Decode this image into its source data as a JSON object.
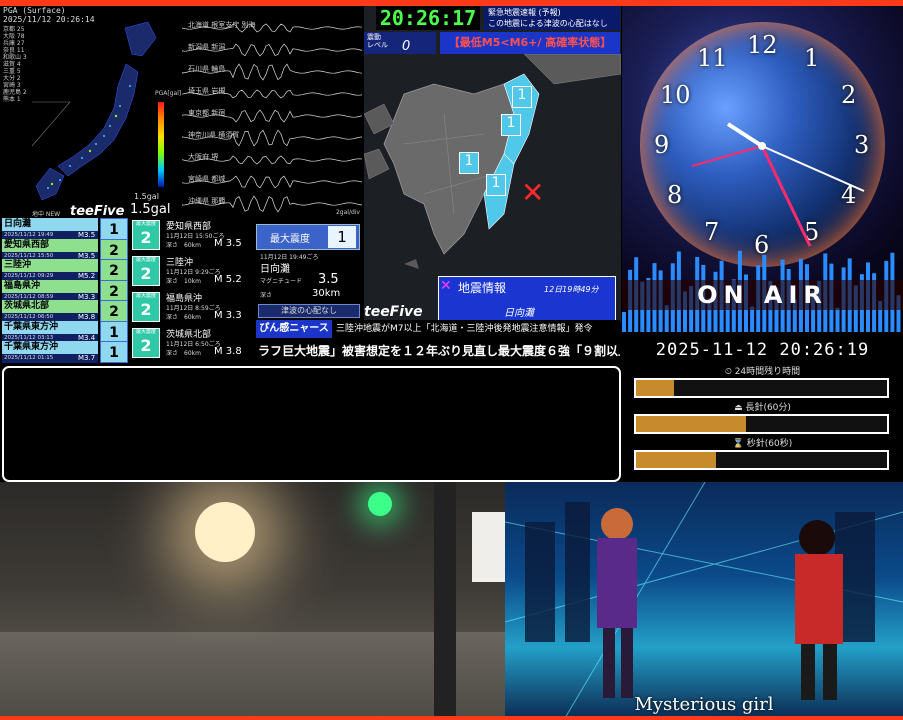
{
  "pga": {
    "title": "PGA (Surface)",
    "timestamp": "2025/11/12 20:26:14",
    "scale_title": "PGA[gal]",
    "gal_small": "1.5gal",
    "gal_large": "1.5gal",
    "stations": [
      "京都 25",
      "大阪 78",
      "兵庫 27",
      "奈良 11",
      "和歌山 3",
      "滋賀 4",
      "三重 5",
      "大分 2",
      "宮崎 3",
      "鹿児島 2",
      "熊本 1"
    ],
    "list_header": "最大1"
  },
  "waves": {
    "labels": [
      "北海道 根室支庁 別海",
      "新潟県 新潟",
      "石川県 輪島",
      "埼玉県 岩槻",
      "東京都 新宿",
      "神奈川県 横須賀",
      "大阪府 堺",
      "宮崎県 都城",
      "沖縄県 那覇"
    ],
    "footer": "2gal/div"
  },
  "eq_map": {
    "time": "20:26:17",
    "tsunami_line1": "緊急地震速報 (予報)",
    "tsunami_line2": "この地震による津波の心配はなし",
    "level_label_1": "震動",
    "level_label_2": "レベル",
    "level_value": "0",
    "banner": "【最低M5<M6+/ 高確率状態】",
    "info_title": "地震情報",
    "info_time": "12日19時49分",
    "info_place": "日向灘",
    "brand": "teeFive",
    "marker_values": [
      "1",
      "1",
      "1",
      "1"
    ]
  },
  "eq_list": {
    "brand": "teeFive",
    "new_label": "地中 NEW",
    "rows": [
      {
        "name": "日向灘",
        "time": "2025/11/12 19:49",
        "mag": "M3.5",
        "intensity": "1",
        "color": "#8fd8f0"
      },
      {
        "name": "愛知県西部",
        "time": "2025/11/12 15:50",
        "mag": "M3.5",
        "intensity": "2",
        "color": "#8ee08e"
      },
      {
        "name": "三陸沖",
        "time": "2025/11/12 09:29",
        "mag": "M5.2",
        "intensity": "2",
        "color": "#8ee08e"
      },
      {
        "name": "福島県沖",
        "time": "2025/11/12 08:59",
        "mag": "M3.3",
        "intensity": "2",
        "color": "#8ee08e"
      },
      {
        "name": "茨城県北部",
        "time": "2025/11/12 06:50",
        "mag": "M3.8",
        "intensity": "2",
        "color": "#8ee08e"
      },
      {
        "name": "千葉県東方沖",
        "time": "2025/11/12 03:13",
        "mag": "M3.4",
        "intensity": "1",
        "color": "#8fd8f0"
      },
      {
        "name": "千葉県東方沖",
        "time": "2025/11/12 01:15",
        "mag": "M3.7",
        "intensity": "1",
        "color": "#8fd8f0"
      }
    ]
  },
  "eq_cards": [
    {
      "intensity_label": "最大震度",
      "intensity": "2",
      "name": "愛知県西部",
      "time": "11月12日 15:50ごろ",
      "depth": "深さ　60km",
      "mag": "M 3.5"
    },
    {
      "intensity_label": "最大震度",
      "intensity": "2",
      "name": "三陸沖",
      "time": "11月12日 9:29ごろ",
      "depth": "深さ　10km",
      "mag": "M 5.2"
    },
    {
      "intensity_label": "最大震度",
      "intensity": "2",
      "name": "福島県沖",
      "time": "11月12日 8:59ごろ",
      "depth": "深さ　60km",
      "mag": "M 3.3"
    },
    {
      "intensity_label": "最大震度",
      "intensity": "2",
      "name": "茨城県北部",
      "time": "11月12日 6:50ごろ",
      "depth": "深さ　60km",
      "mag": "M 3.8"
    }
  ],
  "max_panel": {
    "label": "最大震度",
    "value": "1",
    "time": "11月12日 19:49ごろ",
    "place": "日向灘",
    "mag_label": "マグニチュード",
    "mag_value": "3.5",
    "depth_label": "深さ",
    "depth_value": "30km",
    "tsunami": "津波の心配なし"
  },
  "ticker": {
    "tag": "ぴん感ニャース",
    "line1": "三陸沖地震がM7以上「北海道・三陸沖後発地震注意情報」発令",
    "line2": "ラフ巨大地震」被害想定を１２年ぶり見直し最大震度６強「９割以上」"
  },
  "clock": {
    "numbers": [
      "12",
      "1",
      "2",
      "3",
      "4",
      "5",
      "6",
      "7",
      "8",
      "9",
      "10",
      "11"
    ],
    "onair": "ON AIR"
  },
  "progress": {
    "datetime": "2025-11-12 20:26:19",
    "items": [
      {
        "label": "⏲ 24時間残り時間",
        "percent": 15
      },
      {
        "label": "⏏ 長針(60分)",
        "percent": 44
      },
      {
        "label": "⌛ 秒針(60秒)",
        "percent": 32
      }
    ]
  },
  "stage": {
    "caption": "Mysterious girl"
  },
  "colors": {
    "accent_red": "#ff3a1a",
    "clock_green": "#4bff4b",
    "banner_blue": "#1a35c8",
    "progress_fill": "#c78a2c"
  }
}
